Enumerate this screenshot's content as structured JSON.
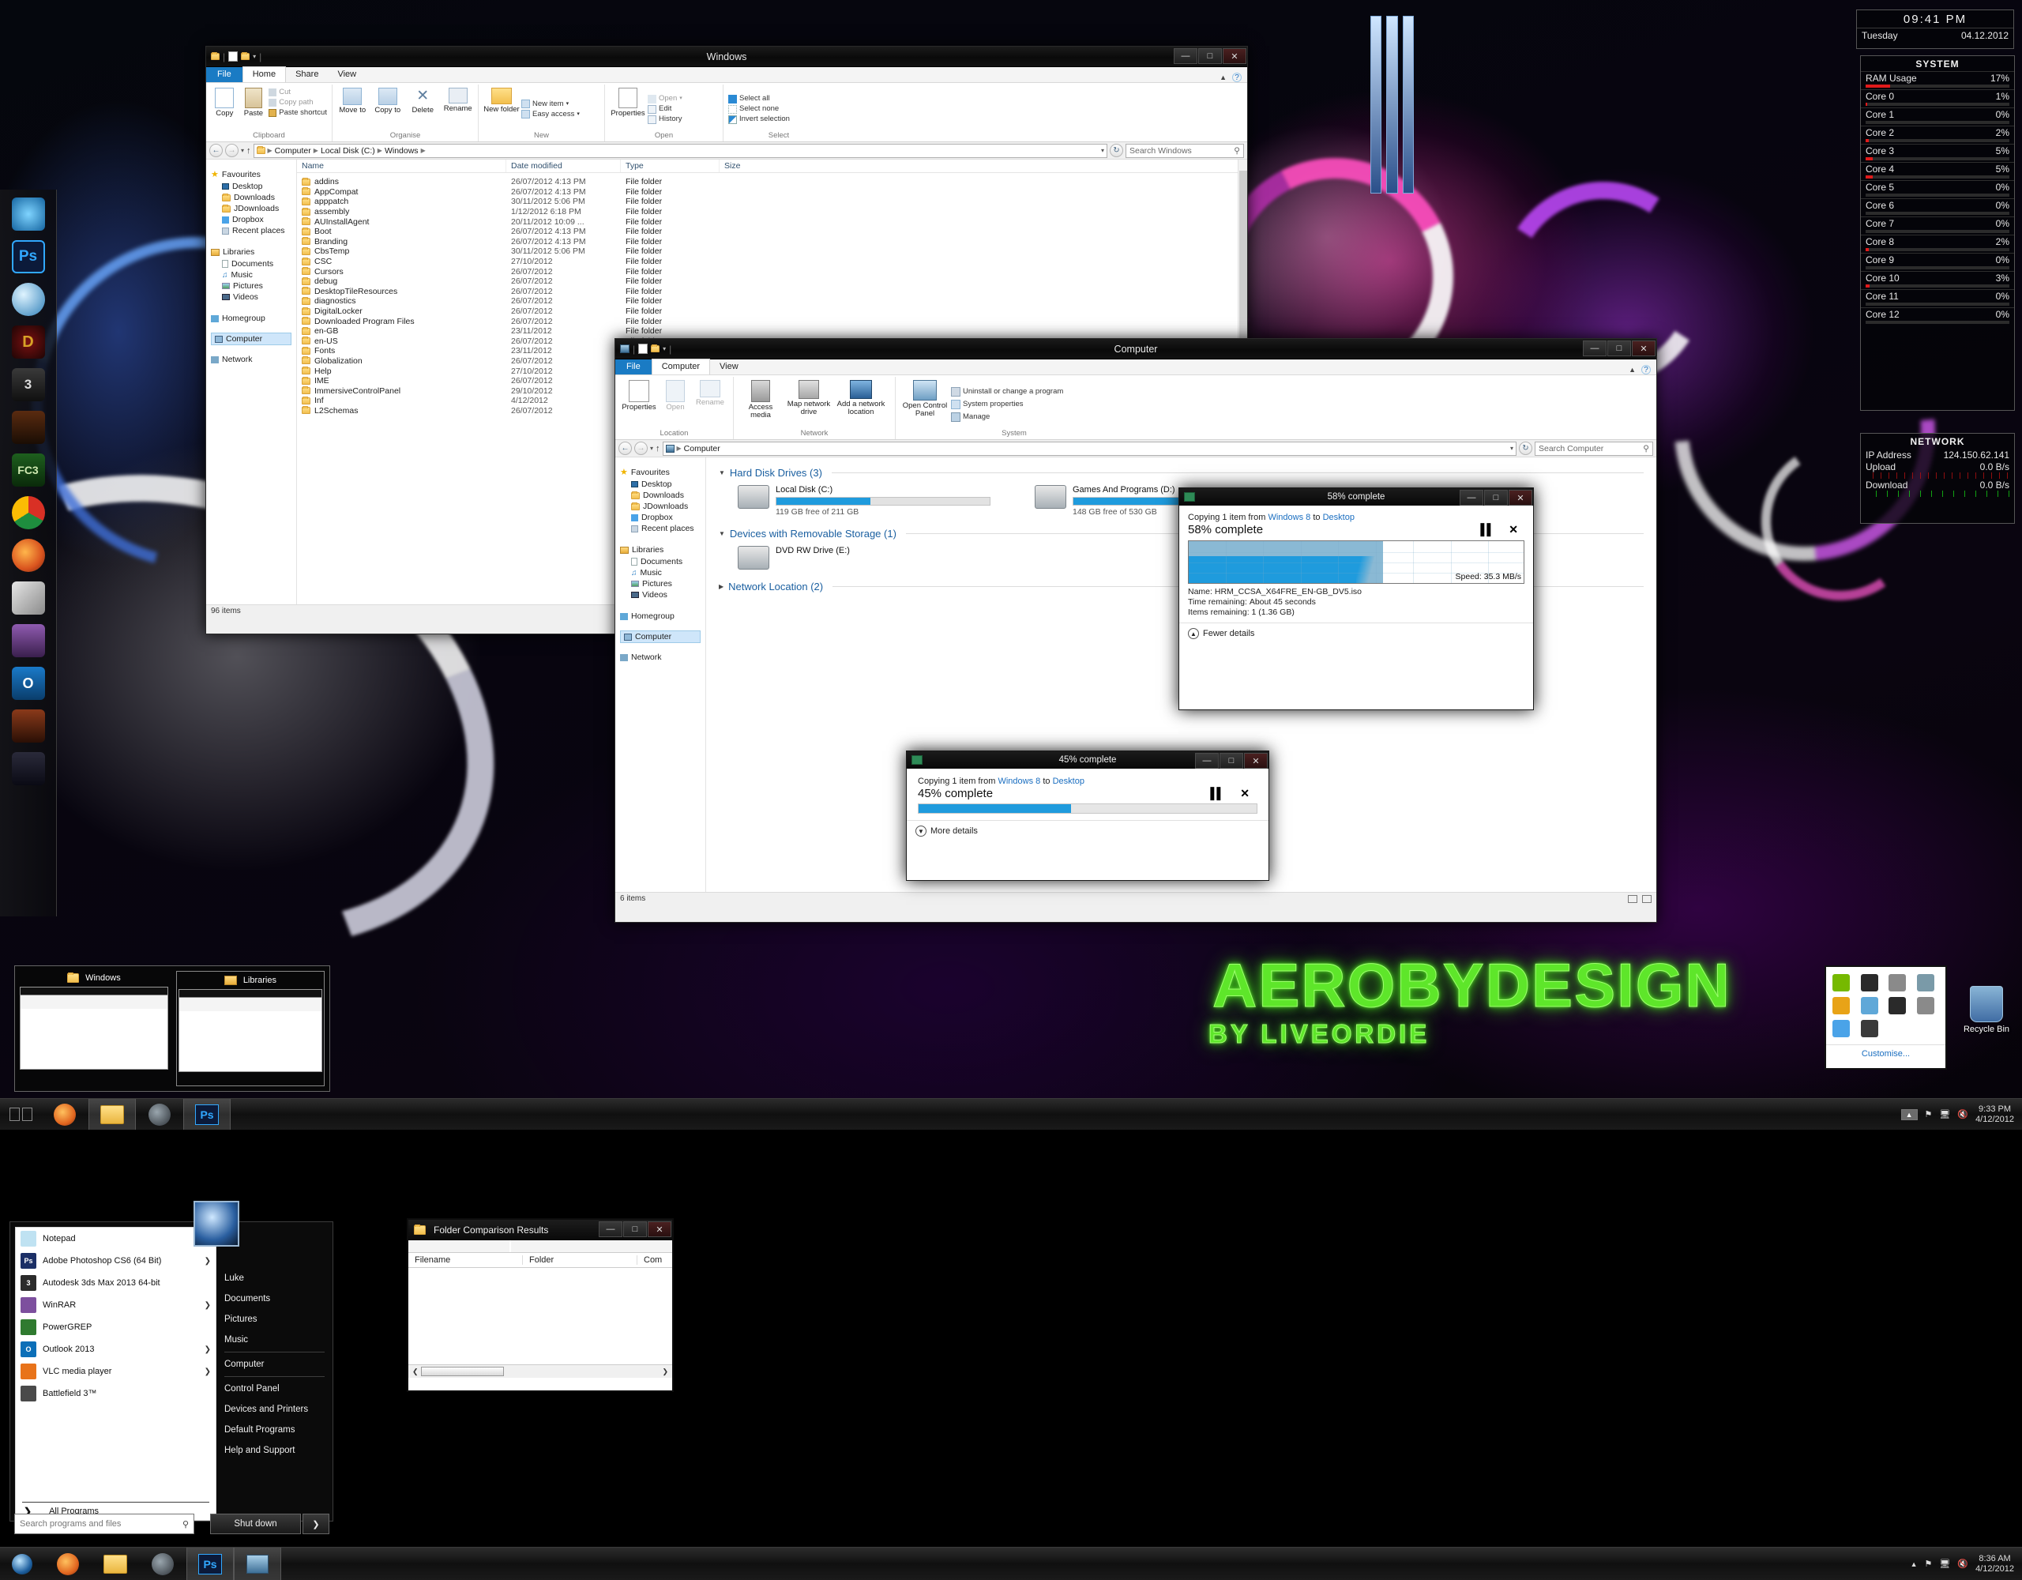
{
  "theme": {
    "accent": "#1f9bdd",
    "neon": "#5ee62a",
    "ribbon_file": "#1a7bc4"
  },
  "branding": {
    "line1": "AEROBYDESIGN",
    "line2": "BY LIVEORDIE"
  },
  "explorer_windows": {
    "title": "Windows",
    "tabs": {
      "file": "File",
      "home": "Home",
      "share": "Share",
      "view": "View"
    },
    "ribbon_groups": [
      {
        "label": "Clipboard",
        "big": [
          "Copy",
          "Paste"
        ],
        "small": [
          "Cut",
          "Copy path",
          "Paste shortcut"
        ]
      },
      {
        "label": "Organise",
        "big": [
          "Move to",
          "Copy to",
          "Delete",
          "Rename"
        ],
        "small": []
      },
      {
        "label": "New",
        "big": [
          "New folder"
        ],
        "small": [
          "New item",
          "Easy access"
        ]
      },
      {
        "label": "Open",
        "big": [
          "Properties"
        ],
        "small": [
          "Open",
          "Edit",
          "History"
        ]
      },
      {
        "label": "Select",
        "big": [],
        "small": [
          "Select all",
          "Select none",
          "Invert selection"
        ]
      }
    ],
    "breadcrumb": [
      "Computer",
      "Local Disk (C:)",
      "Windows"
    ],
    "search_placeholder": "Search Windows",
    "nav": {
      "favourites": {
        "label": "Favourites",
        "items": [
          "Desktop",
          "Downloads",
          "JDownloads",
          "Dropbox",
          "Recent places"
        ]
      },
      "libraries": {
        "label": "Libraries",
        "items": [
          "Documents",
          "Music",
          "Pictures",
          "Videos"
        ]
      },
      "homegroup": "Homegroup",
      "computer": "Computer",
      "network": "Network"
    },
    "columns": [
      "Name",
      "Date modified",
      "Type",
      "Size"
    ],
    "rows": [
      {
        "name": "addins",
        "date": "26/07/2012 4:13 PM",
        "type": "File folder",
        "size": ""
      },
      {
        "name": "AppCompat",
        "date": "26/07/2012 4:13 PM",
        "type": "File folder",
        "size": ""
      },
      {
        "name": "apppatch",
        "date": "30/11/2012 5:06 PM",
        "type": "File folder",
        "size": ""
      },
      {
        "name": "assembly",
        "date": "1/12/2012 6:18 PM",
        "type": "File folder",
        "size": ""
      },
      {
        "name": "AUInstallAgent",
        "date": "20/11/2012 10:09 ...",
        "type": "File folder",
        "size": ""
      },
      {
        "name": "Boot",
        "date": "26/07/2012 4:13 PM",
        "type": "File folder",
        "size": ""
      },
      {
        "name": "Branding",
        "date": "26/07/2012 4:13 PM",
        "type": "File folder",
        "size": ""
      },
      {
        "name": "CbsTemp",
        "date": "30/11/2012 5:06 PM",
        "type": "File folder",
        "size": ""
      },
      {
        "name": "CSC",
        "date": "27/10/2012",
        "type": "File folder",
        "size": ""
      },
      {
        "name": "Cursors",
        "date": "26/07/2012",
        "type": "File folder",
        "size": ""
      },
      {
        "name": "debug",
        "date": "26/07/2012",
        "type": "File folder",
        "size": ""
      },
      {
        "name": "DesktopTileResources",
        "date": "26/07/2012",
        "type": "File folder",
        "size": ""
      },
      {
        "name": "diagnostics",
        "date": "26/07/2012",
        "type": "File folder",
        "size": ""
      },
      {
        "name": "DigitalLocker",
        "date": "26/07/2012",
        "type": "File folder",
        "size": ""
      },
      {
        "name": "Downloaded Program Files",
        "date": "26/07/2012",
        "type": "File folder",
        "size": ""
      },
      {
        "name": "en-GB",
        "date": "23/11/2012",
        "type": "File folder",
        "size": ""
      },
      {
        "name": "en-US",
        "date": "26/07/2012",
        "type": "File folder",
        "size": ""
      },
      {
        "name": "Fonts",
        "date": "23/11/2012",
        "type": "File folder",
        "size": ""
      },
      {
        "name": "Globalization",
        "date": "26/07/2012",
        "type": "File folder",
        "size": ""
      },
      {
        "name": "Help",
        "date": "27/10/2012",
        "type": "File folder",
        "size": ""
      },
      {
        "name": "IME",
        "date": "26/07/2012",
        "type": "File folder",
        "size": ""
      },
      {
        "name": "ImmersiveControlPanel",
        "date": "29/10/2012",
        "type": "File folder",
        "size": ""
      },
      {
        "name": "Inf",
        "date": "4/12/2012",
        "type": "File folder",
        "size": ""
      },
      {
        "name": "L2Schemas",
        "date": "26/07/2012",
        "type": "File folder",
        "size": ""
      }
    ],
    "status": "96 items"
  },
  "computer_window": {
    "title": "Computer",
    "tabs": {
      "file": "File",
      "computer": "Computer",
      "view": "View"
    },
    "ribbon_groups": [
      {
        "label": "Location",
        "big": [
          "Properties",
          "Open",
          "Rename"
        ],
        "small": []
      },
      {
        "label": "Network",
        "big": [
          "Access media",
          "Map network drive",
          "Add a network location"
        ],
        "small": []
      },
      {
        "label": "System",
        "big": [
          "Open Control Panel"
        ],
        "small": [
          "Uninstall or change a program",
          "System properties",
          "Manage"
        ]
      }
    ],
    "breadcrumb": [
      "Computer"
    ],
    "search_placeholder": "Search Computer",
    "nav": {
      "favourites": {
        "label": "Favourites",
        "items": [
          "Desktop",
          "Downloads",
          "JDownloads",
          "Dropbox",
          "Recent places"
        ]
      },
      "libraries": {
        "label": "Libraries",
        "items": [
          "Documents",
          "Music",
          "Pictures",
          "Videos"
        ]
      },
      "homegroup": "Homegroup",
      "computer": "Computer",
      "network": "Network"
    },
    "sections": [
      {
        "heading": "Hard Disk Drives (3)",
        "expanded": true,
        "drives": [
          {
            "label": "Local Disk (C:)",
            "free": "119 GB free of 211 GB",
            "used_pct": 44
          },
          {
            "label": "Games And Programs (D:)",
            "free": "148 GB free of 530 GB",
            "used_pct": 72
          }
        ]
      },
      {
        "heading": "Devices with Removable Storage (1)",
        "expanded": true,
        "drives": [
          {
            "label": "DVD RW Drive (E:)",
            "free": "",
            "used_pct": 0
          }
        ]
      },
      {
        "heading": "Network Location (2)",
        "expanded": false,
        "drives": []
      }
    ],
    "status": "6 items"
  },
  "copy_dialog_large": {
    "title": "58% complete",
    "line": {
      "prefix": "Copying 1 item from ",
      "source": "Windows 8",
      "mid": " to ",
      "dest": "Desktop"
    },
    "percent_label": "58% complete",
    "percent": 58,
    "speed": "Speed: 35.3 MB/s",
    "name_label": "Name:",
    "name_value": "HRM_CCSA_X64FRE_EN-GB_DV5.iso",
    "time_label": "Time remaining:",
    "time_value": "About 45 seconds",
    "items_label": "Items remaining:",
    "items_value": "1 (1.36 GB)",
    "details_toggle": "Fewer details",
    "pause_icon": "pause-icon",
    "cancel_icon": "close-icon"
  },
  "copy_dialog_small": {
    "title": "45% complete",
    "line": {
      "prefix": "Copying 1 item from ",
      "source": "Windows 8",
      "mid": " to ",
      "dest": "Desktop"
    },
    "percent_label": "45% complete",
    "percent": 45,
    "details_toggle": "More details"
  },
  "folder_compare": {
    "title": "Folder Comparison Results",
    "columns": [
      "Filename",
      "Folder",
      "Com"
    ],
    "rows": []
  },
  "clock_gadget": {
    "time": "09:41 PM",
    "day": "Tuesday",
    "date": "04.12.2012"
  },
  "system_gadget": {
    "title": "SYSTEM",
    "rows": [
      {
        "label": "RAM Usage",
        "value": "17%",
        "pct": 17
      },
      {
        "label": "Core 0",
        "value": "1%",
        "pct": 1
      },
      {
        "label": "Core 1",
        "value": "0%",
        "pct": 0
      },
      {
        "label": "Core 2",
        "value": "2%",
        "pct": 2
      },
      {
        "label": "Core 3",
        "value": "5%",
        "pct": 5
      },
      {
        "label": "Core 4",
        "value": "5%",
        "pct": 5
      },
      {
        "label": "Core 5",
        "value": "0%",
        "pct": 0
      },
      {
        "label": "Core 6",
        "value": "0%",
        "pct": 0
      },
      {
        "label": "Core 7",
        "value": "0%",
        "pct": 0
      },
      {
        "label": "Core 8",
        "value": "2%",
        "pct": 2
      },
      {
        "label": "Core 9",
        "value": "0%",
        "pct": 0
      },
      {
        "label": "Core 10",
        "value": "3%",
        "pct": 3
      },
      {
        "label": "Core 11",
        "value": "0%",
        "pct": 0
      },
      {
        "label": "Core 12",
        "value": "0%",
        "pct": 0
      }
    ]
  },
  "network_gadget": {
    "title": "NETWORK",
    "rows": [
      {
        "label": "IP Address",
        "value": "124.150.62.141"
      },
      {
        "label": "Upload",
        "value": "0.0 B/s"
      },
      {
        "label": "Download",
        "value": "0.0 B/s"
      }
    ]
  },
  "tray_flyout": {
    "customise": "Customise...",
    "icons": [
      "nvidia-icon",
      "recording-icon",
      "usb-safe-remove-icon",
      "update-icon",
      "network-shield-icon",
      "water-drop-icon",
      "mouse-icon",
      "x-icon",
      "dropbox-icon",
      "msi-afterburner-icon"
    ]
  },
  "desktop_icons": [
    {
      "label": "Recycle Bin",
      "icon": "recycle-bin-icon"
    }
  ],
  "taskbar_top": {
    "clock_time": "9:33 PM",
    "clock_date": "4/12/2012",
    "items": [
      "show-desktop-icon",
      "firefox-icon",
      "explorer-icon",
      "steam-icon",
      "photoshop-icon"
    ]
  },
  "taskbar_bottom": {
    "clock_time": "8:36 AM",
    "clock_date": "4/12/2012",
    "items": [
      "start-icon",
      "firefox-icon",
      "explorer-icon",
      "steam-icon",
      "photoshop-icon",
      "computer-icon"
    ]
  },
  "thumb_previews": [
    {
      "title": "Windows",
      "icon": "folder-icon"
    },
    {
      "title": "Libraries",
      "icon": "libraries-icon"
    }
  ],
  "start_menu": {
    "programs": [
      {
        "label": "Notepad",
        "icon": "notepad-icon",
        "has_submenu": true,
        "color": "#bfe2f2",
        "short": ""
      },
      {
        "label": "Adobe Photoshop CS6 (64 Bit)",
        "icon": "photoshop-icon",
        "has_submenu": true,
        "color": "#1b2f66",
        "short": "Ps"
      },
      {
        "label": "Autodesk 3ds Max 2013 64-bit",
        "icon": "3dsmax-icon",
        "has_submenu": false,
        "color": "#2b2b2b",
        "short": "3"
      },
      {
        "label": "WinRAR",
        "icon": "winrar-icon",
        "has_submenu": true,
        "color": "#7d4f9e",
        "short": ""
      },
      {
        "label": "PowerGREP",
        "icon": "powergrep-icon",
        "has_submenu": false,
        "color": "#2f7a2f",
        "short": ""
      },
      {
        "label": "Outlook 2013",
        "icon": "outlook-icon",
        "has_submenu": true,
        "color": "#0b6fb8",
        "short": "O"
      },
      {
        "label": "VLC media player",
        "icon": "vlc-icon",
        "has_submenu": true,
        "color": "#e8731a",
        "short": ""
      },
      {
        "label": "Battlefield 3™",
        "icon": "battlefield-icon",
        "has_submenu": false,
        "color": "#4a4a4a",
        "short": ""
      }
    ],
    "all_programs": "All Programs",
    "search_placeholder": "Search programs and files",
    "right_items": [
      "Luke",
      "Documents",
      "Pictures",
      "Music",
      "Computer",
      "Control Panel",
      "Devices and Printers",
      "Default Programs",
      "Help and Support"
    ],
    "shutdown": "Shut down"
  }
}
